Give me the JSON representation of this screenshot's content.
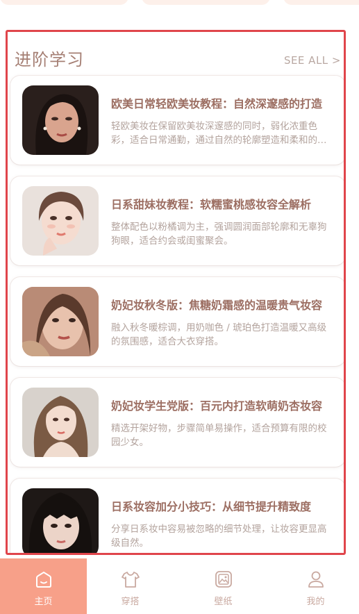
{
  "section": {
    "title": "进阶学习",
    "see_all": "SEE ALL >"
  },
  "cards": [
    {
      "title": "欧美日常轻欧美妆教程：自然深邃感的打造",
      "desc": "轻欧美妆在保留欧美妆深邃感的同时，弱化浓重色彩，适合日常通勤，通过自然的轮廓塑造和柔和的眼妆展现立体五官。"
    },
    {
      "title": "日系甜妹妆教程：软糯蜜桃感妆容全解析",
      "desc": "整体配色以粉橘调为主，强调圆润面部轮廓和无辜狗狗眼，适合约会或闺蜜聚会。"
    },
    {
      "title": "奶妃妆秋冬版：焦糖奶霜感的温暖贵气妆容",
      "desc": "融入秋冬暖棕调，用奶咖色 / 琥珀色打造温暖又高级的氛围感，适合大衣穿搭。"
    },
    {
      "title": "奶妃妆学生党版：百元内打造软萌奶杏妆容",
      "desc": "精选开架好物，步骤简单易操作，适合预算有限的校园少女。"
    },
    {
      "title": "日系妆容加分小技巧：从细节提升精致度",
      "desc": "分享日系妆中容易被忽略的细节处理，让妆容更显高级自然。"
    }
  ],
  "tabs": [
    {
      "label": "主页",
      "icon": "home-icon"
    },
    {
      "label": "穿搭",
      "icon": "shirt-icon"
    },
    {
      "label": "壁纸",
      "icon": "wallpaper-icon"
    },
    {
      "label": "我的",
      "icon": "profile-icon"
    }
  ],
  "colors": {
    "accent": "#f7a089",
    "title_text": "#9c6e62",
    "highlight_border": "#e0454b"
  }
}
